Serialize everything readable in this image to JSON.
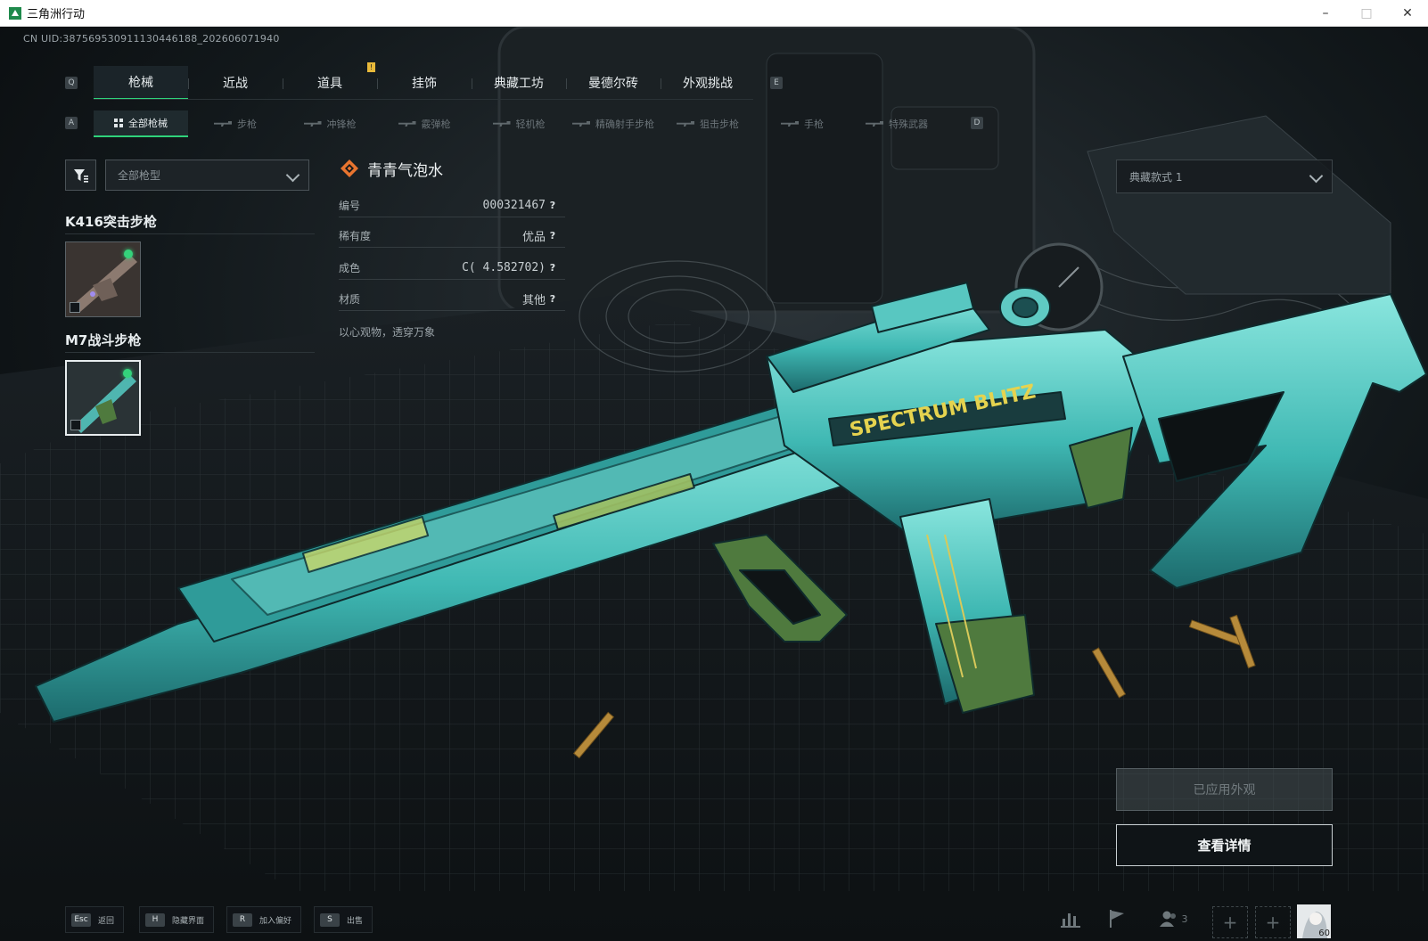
{
  "window": {
    "title": "三角洲行动",
    "minimize": "–",
    "maximize": "□",
    "close": "✕"
  },
  "uid_text": "CN UID:387569530911130446188_202606071940",
  "category_keys": {
    "prev": "Q",
    "next": "E"
  },
  "category_tabs": [
    {
      "label": "枪械",
      "active": true
    },
    {
      "label": "近战",
      "active": false
    },
    {
      "label": "道具",
      "active": false,
      "badge": "!"
    },
    {
      "label": "挂饰",
      "active": false
    },
    {
      "label": "典藏工坊",
      "active": false
    },
    {
      "label": "曼德尔砖",
      "active": false
    },
    {
      "label": "外观挑战",
      "active": false
    }
  ],
  "sub_keys": {
    "prev": "A",
    "next": "D"
  },
  "weapon_tabs": [
    {
      "label": "全部枪械",
      "active": true,
      "icon": "grid-icon"
    },
    {
      "label": "步枪",
      "icon": "rifle-icon"
    },
    {
      "label": "冲锋枪",
      "icon": "smg-icon"
    },
    {
      "label": "霰弹枪",
      "icon": "shotgun-icon"
    },
    {
      "label": "轻机枪",
      "icon": "lmg-icon"
    },
    {
      "label": "精确射手步枪",
      "icon": "dmr-icon"
    },
    {
      "label": "狙击步枪",
      "icon": "sniper-icon"
    },
    {
      "label": "手枪",
      "icon": "pistol-icon"
    },
    {
      "label": "特殊武器",
      "icon": "special-icon"
    }
  ],
  "filter": {
    "type_value": "全部枪型"
  },
  "weapon_groups": [
    {
      "name": "K416突击步枪",
      "selected": false,
      "owned": true
    },
    {
      "name": "M7战斗步枪",
      "selected": true,
      "owned": true
    }
  ],
  "skin": {
    "name": "青青气泡水",
    "stats": [
      {
        "label": "编号",
        "value": "000321467"
      },
      {
        "label": "稀有度",
        "value": "优品"
      },
      {
        "label": "成色",
        "value": "C( 4.582702)"
      },
      {
        "label": "材质",
        "value": "其他"
      }
    ],
    "help": "?",
    "description": "以心观物，透穿万象"
  },
  "gun_decal": "SPECTRUM BLITZ",
  "style_select": {
    "value": "典藏款式 1"
  },
  "buttons": {
    "applied": "已应用外观",
    "details": "查看详情"
  },
  "footer_hints": [
    {
      "key": "Esc",
      "label": "返回"
    },
    {
      "key": "H",
      "label": "隐藏界面"
    },
    {
      "key": "R",
      "label": "加入偏好"
    },
    {
      "key": "S",
      "label": "出售"
    }
  ],
  "footer": {
    "friends_count": "3",
    "plus": "+",
    "avatar_level": "60"
  },
  "colors": {
    "accent": "#2fd27a",
    "gun_teal": "#3fb8b3",
    "gun_green": "#4f7a3e",
    "skin_icon": "#e8742f"
  }
}
